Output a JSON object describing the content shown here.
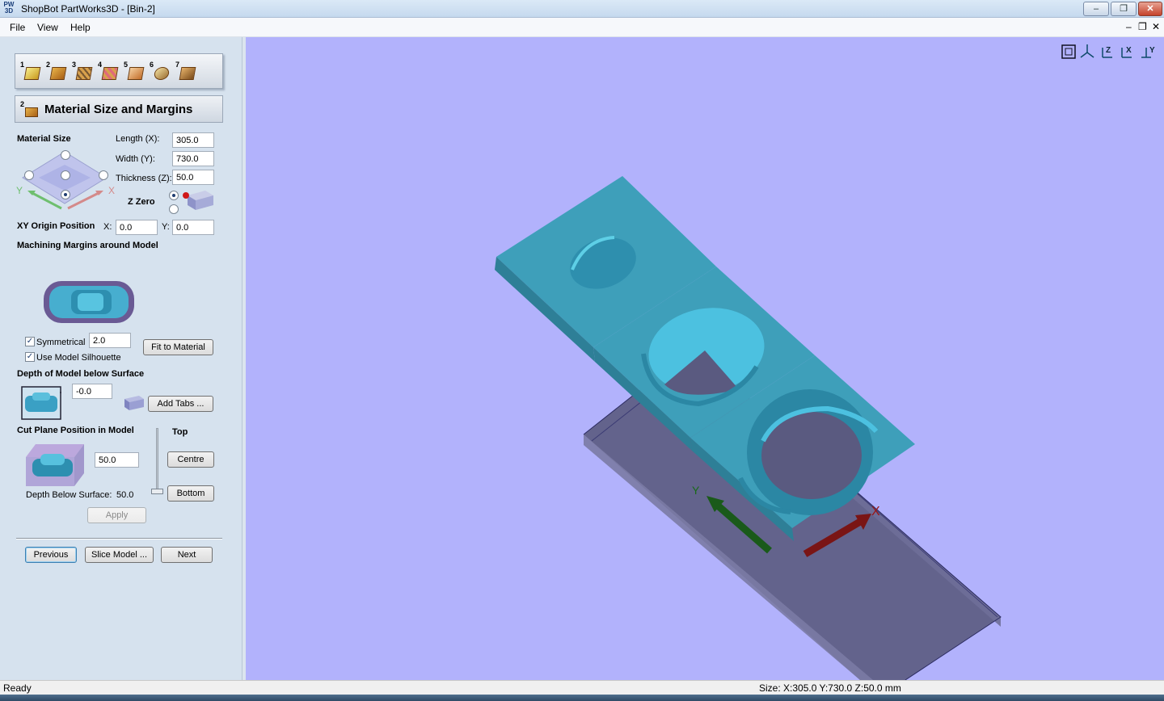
{
  "window": {
    "icon_label": "PW 3D",
    "title": "ShopBot PartWorks3D - [Bin-2]",
    "minimize": "‒",
    "maximize": "❐",
    "close": "✕"
  },
  "menu": {
    "file": "File",
    "view": "View",
    "help": "Help",
    "mdi_restore": "❐",
    "mdi_close": "✕"
  },
  "steps": [
    "1",
    "2",
    "3",
    "4",
    "5",
    "6",
    "7"
  ],
  "section": {
    "number": "2",
    "title": "Material Size and Margins"
  },
  "material": {
    "heading": "Material Size",
    "length_label": "Length (X):",
    "length_value": "305.0",
    "width_label": "Width (Y):",
    "width_value": "730.0",
    "thickness_label": "Thickness (Z):",
    "thickness_value": "50.0",
    "axis_y": "Y",
    "axis_x": "X",
    "z_zero_label": "Z Zero"
  },
  "origin": {
    "label": "XY Origin Position",
    "x_label": "X:",
    "x_value": "0.0",
    "y_label": "Y:",
    "y_value": "0.0"
  },
  "margins": {
    "heading": "Machining Margins around Model",
    "symmetrical_label": "Symmetrical",
    "symmetrical_checked": true,
    "margin_value": "2.0",
    "fit_button": "Fit to Material",
    "silhouette_label": "Use Model Silhouette",
    "silhouette_checked": true
  },
  "depth": {
    "heading": "Depth of Model below Surface",
    "value": "-0.0",
    "add_tabs_button": "Add Tabs ..."
  },
  "cut_plane": {
    "heading": "Cut Plane Position in Model",
    "top_label": "Top",
    "value": "50.0",
    "centre_button": "Centre",
    "bottom_button": "Bottom",
    "depth_below_label": "Depth Below Surface:",
    "depth_below_value": "50.0",
    "apply_button": "Apply"
  },
  "nav": {
    "previous": "Previous",
    "slice": "Slice Model ...",
    "next": "Next"
  },
  "viewport": {
    "background": "#b2b2fc",
    "view_tools": [
      "fit-view",
      "iso-view",
      "z-view",
      "x-view",
      "y-view"
    ],
    "axis_y": "Y",
    "axis_x": "X"
  },
  "status": {
    "left": "Ready",
    "right": "Size: X:305.0 Y:730.0 Z:50.0 mm"
  }
}
